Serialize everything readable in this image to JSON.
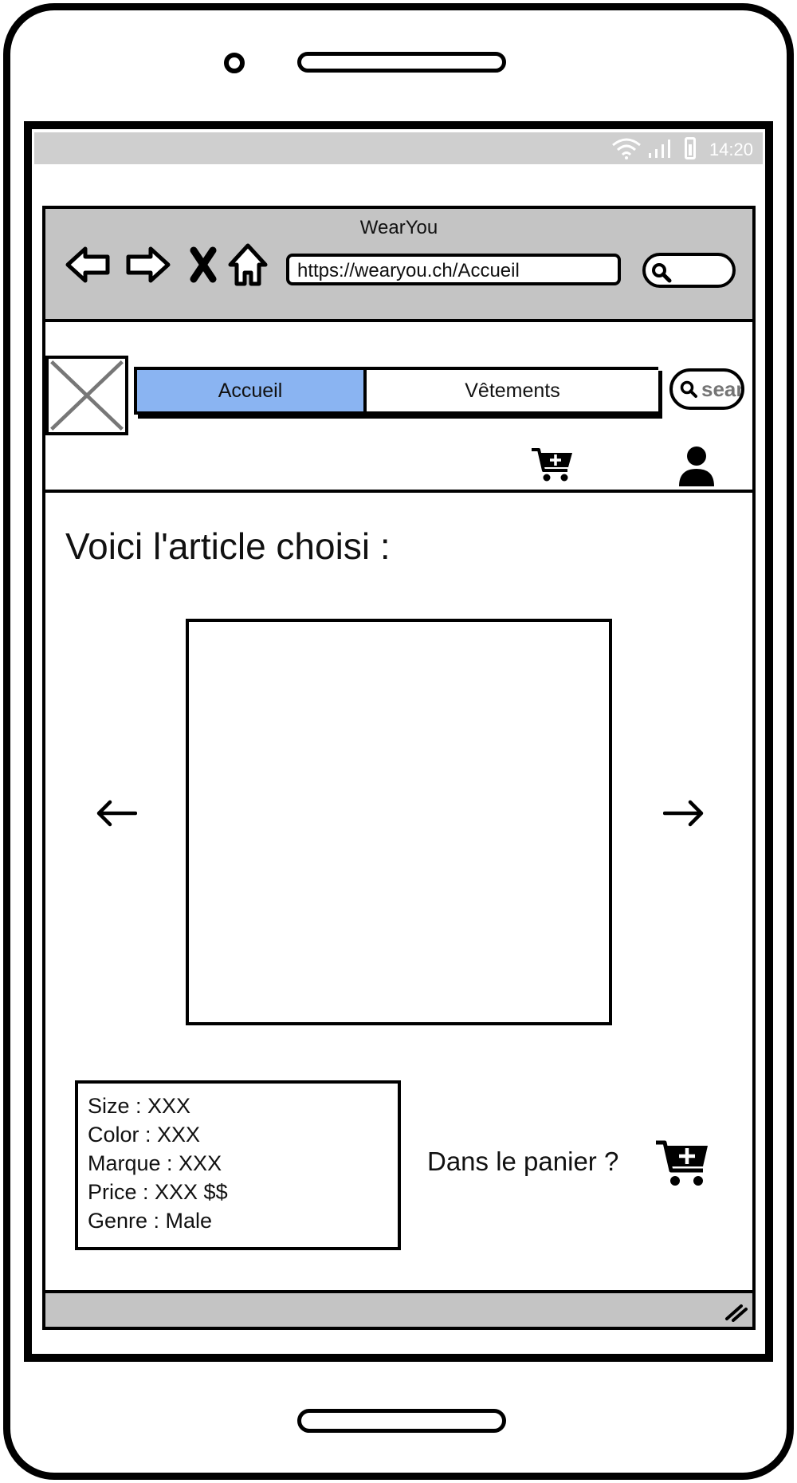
{
  "statusbar": {
    "time": "14:20"
  },
  "browser": {
    "title": "WearYou",
    "url": "https://wearyou.ch/Accueil"
  },
  "site": {
    "nav_tabs": [
      {
        "label": "Accueil",
        "active": true
      },
      {
        "label": "Vêtements",
        "active": false
      }
    ],
    "search_placeholder": "search"
  },
  "content": {
    "heading": "Voici l'article choisi :",
    "details": [
      "Size : XXX",
      "Color : XXX",
      "Marque : XXX",
      "Price : XXX $$",
      "Genre : Male"
    ],
    "cart_question": "Dans le panier ?"
  },
  "colors": {
    "active_tab": "#8ab4f2",
    "chrome_gray": "#c4c4c4",
    "statusbar_gray": "#cfcfcf"
  },
  "icons": [
    "back-arrow-icon",
    "forward-arrow-icon",
    "stop-icon",
    "home-icon",
    "search-icon",
    "logo-placeholder-icon",
    "cart-add-icon",
    "user-icon",
    "arrow-left-icon",
    "arrow-right-icon",
    "resize-grip-icon",
    "wifi-icon",
    "signal-icon",
    "battery-icon"
  ]
}
